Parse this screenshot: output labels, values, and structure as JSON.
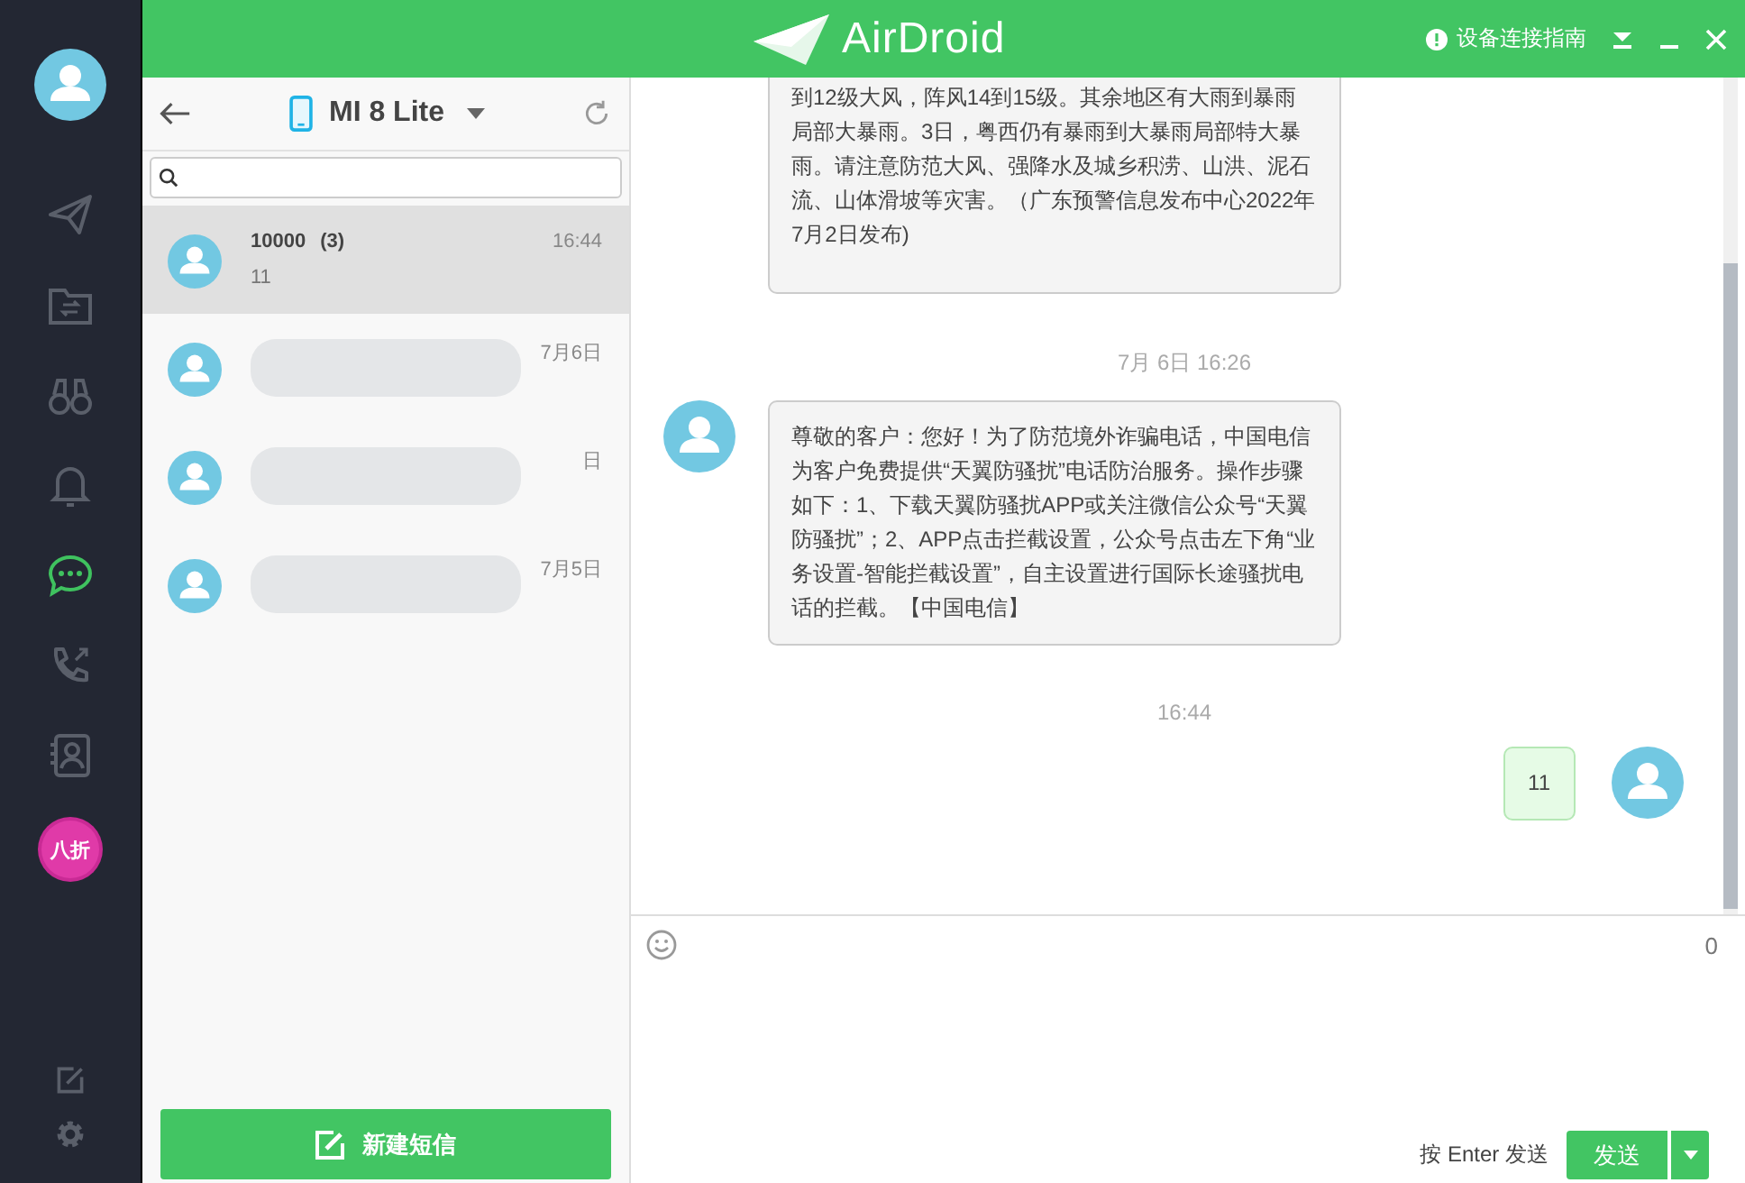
{
  "header": {
    "logo": "AirDroid",
    "guide": "设备连接指南"
  },
  "sidebar": {
    "items": [
      {
        "kind": "send",
        "selected": false
      },
      {
        "kind": "files",
        "selected": false
      },
      {
        "kind": "find",
        "selected": false
      },
      {
        "kind": "notifications",
        "selected": false
      },
      {
        "kind": "messages",
        "selected": true
      },
      {
        "kind": "calls",
        "selected": false
      },
      {
        "kind": "contacts",
        "selected": false
      }
    ],
    "promo_badge": "八折"
  },
  "device": {
    "name": "MI 8 Lite"
  },
  "conversations": [
    {
      "name": "10000",
      "count": "(3)",
      "time": "16:44",
      "preview": "11",
      "selected": true,
      "redacted": false
    },
    {
      "time": "7月6日",
      "selected": false,
      "redacted": true
    },
    {
      "time": "日",
      "selected": false,
      "redacted": true
    },
    {
      "time": "7月5日",
      "selected": false,
      "redacted": true
    }
  ],
  "new_message_button": "新建短信",
  "messages": [
    {
      "kind": "incoming",
      "text": "到12级大风，阵风14到15级。其余地区有大雨到暴雨局部大暴雨。3日，粤西仍有暴雨到大暴雨局部特大暴雨。请注意防范大风、强降水及城乡积涝、山洪、泥石流、山体滑坡等灾害。（广东预警信息发布中心2022年7月2日发布)"
    },
    {
      "kind": "timestamp",
      "text": "7月 6日 16:26"
    },
    {
      "kind": "incoming",
      "text": "尊敬的客户：您好！为了防范境外诈骗电话，中国电信为客户免费提供“天翼防骚扰”电话防治服务。操作步骤如下：1、下载天翼防骚扰APP或关注微信公众号“天翼防骚扰”；2、APP点击拦截设置，公众号点击左下角“业务设置-智能拦截设置”，自主设置进行国际长途骚扰电话的拦截。【中国电信】"
    },
    {
      "kind": "timestamp",
      "text": "16:44"
    },
    {
      "kind": "outgoing",
      "text": "11"
    }
  ],
  "composer": {
    "char_count": "0",
    "hint": "按 Enter 发送",
    "send_button": "发送"
  }
}
